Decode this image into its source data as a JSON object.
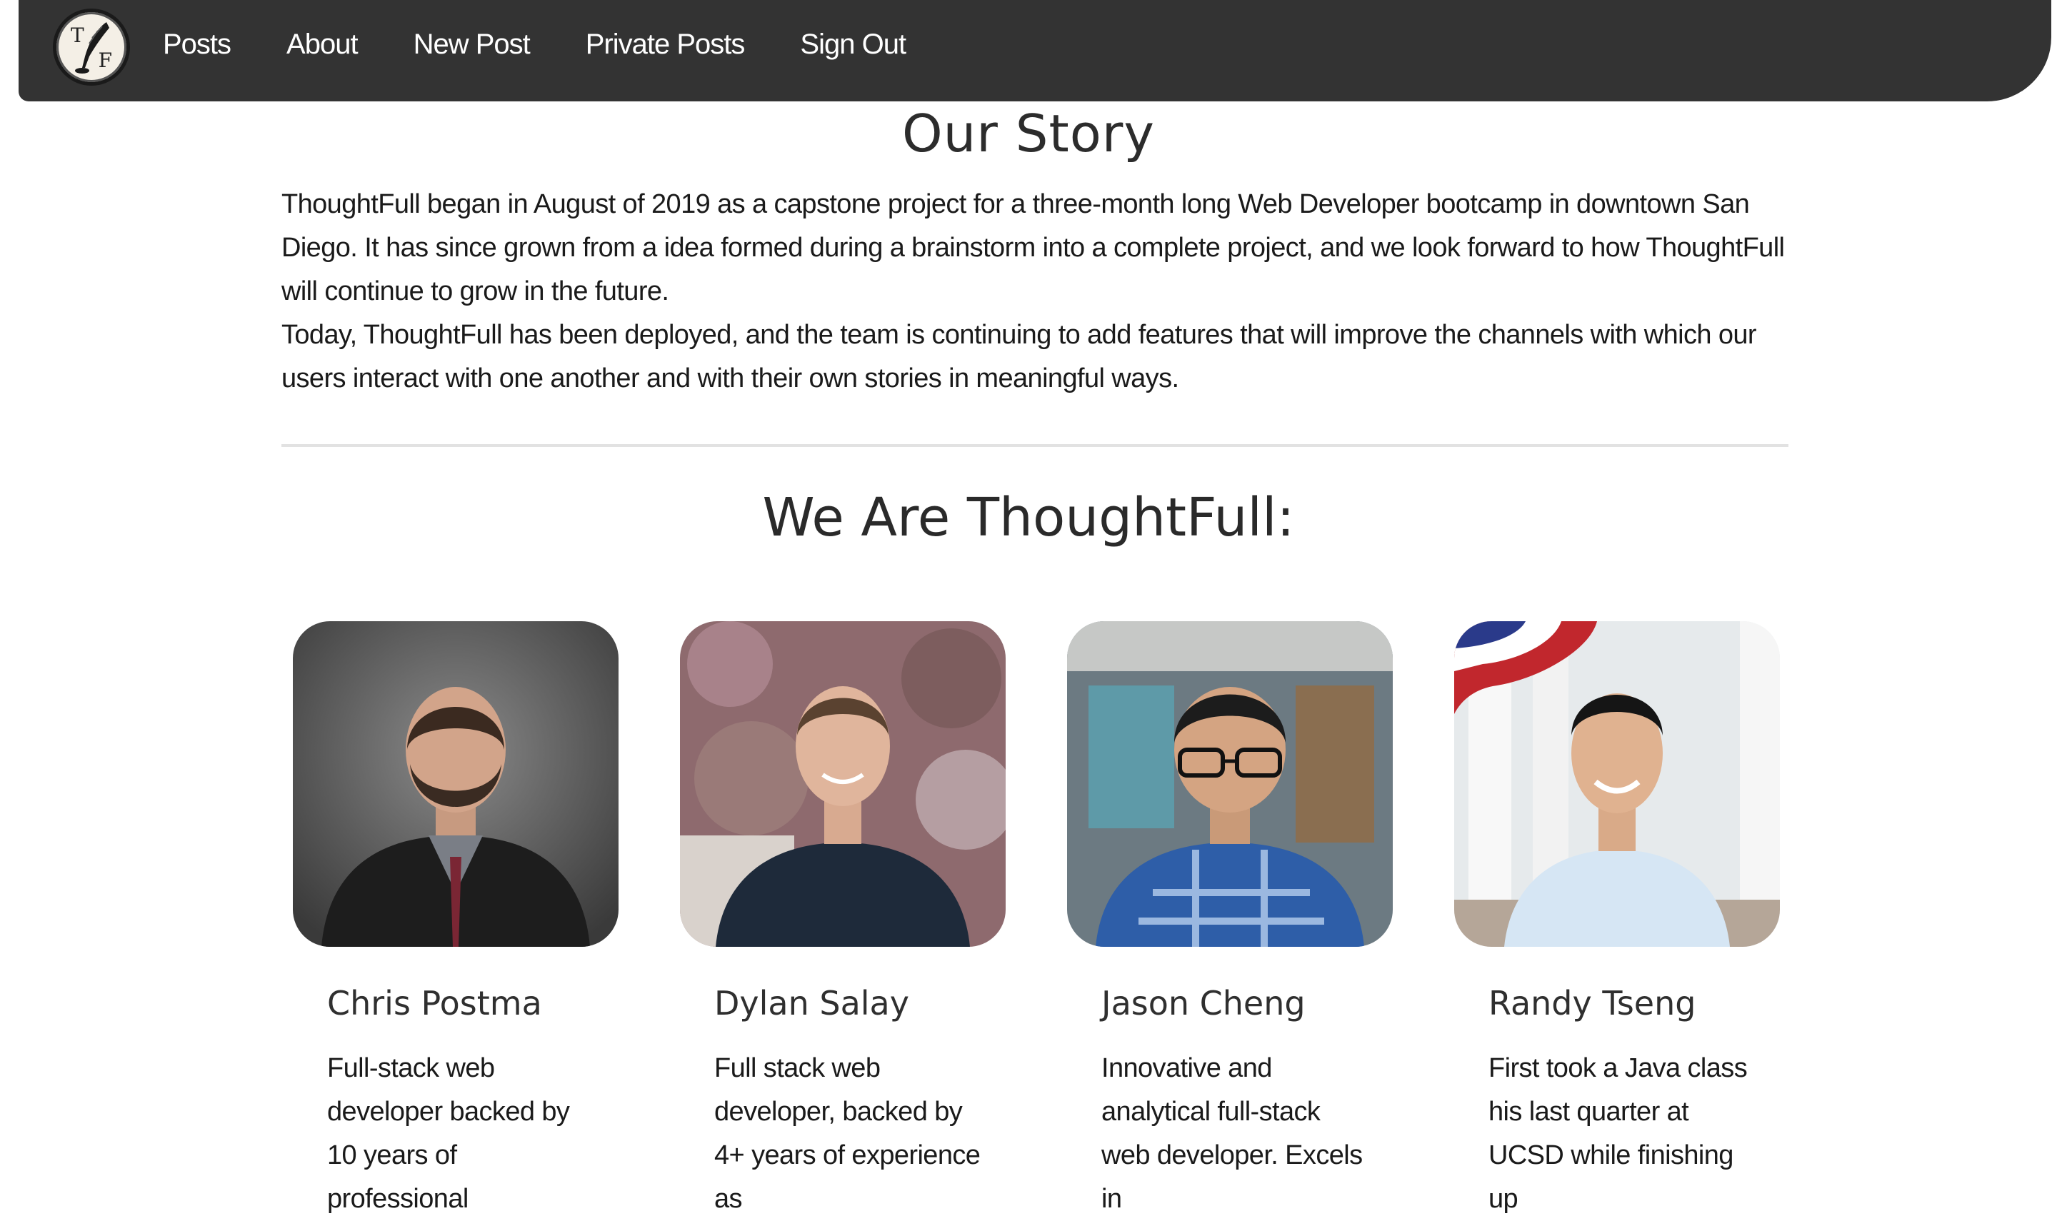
{
  "nav": {
    "logo_letters": {
      "top": "T",
      "bottom": "F"
    },
    "links": [
      "Posts",
      "About",
      "New Post",
      "Private Posts",
      "Sign Out"
    ]
  },
  "story": {
    "title": "Our Story",
    "paragraphs": [
      "ThoughtFull began in August of 2019 as a capstone project for a three-month long Web Developer bootcamp in downtown San Diego. It has since grown from a idea formed during a brainstorm into a complete project, and we look forward to how ThoughtFull will continue to grow in the future.",
      "Today, ThoughtFull has been deployed, and the team is continuing to add features that will improve the channels with which our users interact with one another and with their own stories in meaningful ways."
    ]
  },
  "team": {
    "title": "We Are ThoughtFull:",
    "members": [
      {
        "name": "Chris Postma",
        "bio": "Full-stack web developer backed by 10 years of professional"
      },
      {
        "name": "Dylan Salay",
        "bio": "Full stack web developer, backed by 4+ years of experience as"
      },
      {
        "name": "Jason Cheng",
        "bio": "Innovative and analytical full-stack web developer. Excels in"
      },
      {
        "name": "Randy Tseng",
        "bio": "First took a Java class his last quarter at UCSD while finishing up"
      }
    ]
  },
  "colors": {
    "nav_background": "#333333",
    "nav_text": "#ffffff",
    "divider": "#e2e2e2"
  }
}
